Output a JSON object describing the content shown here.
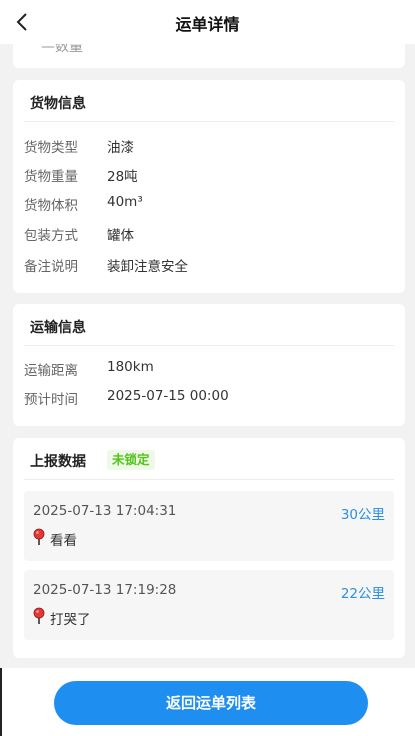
{
  "header": {
    "title": "运单详情",
    "back_icon": "chevron-left-icon"
  },
  "previous_card": {
    "partial_text": "—数量"
  },
  "cargo": {
    "title": "货物信息",
    "rows": [
      {
        "label": "货物类型",
        "value": "油漆"
      },
      {
        "label": "货物重量",
        "value": "28吨"
      },
      {
        "label": "货物体积",
        "value": "40m³"
      },
      {
        "label": "包装方式",
        "value": "罐体"
      },
      {
        "label": "备注说明",
        "value": "装卸注意安全"
      }
    ]
  },
  "transport": {
    "title": "运输信息",
    "rows": [
      {
        "label": "运输距离",
        "value": "180km"
      },
      {
        "label": "预计时间",
        "value": "2025-07-15 00:00"
      }
    ]
  },
  "report": {
    "title": "上报数据",
    "status": "未锁定",
    "status_color": "#52c41a",
    "items": [
      {
        "time": "2025-07-13 17:04:31",
        "distance": "30公里",
        "note": "看看",
        "icon": "map-pin-icon"
      },
      {
        "time": "2025-07-13 17:19:28",
        "distance": "22公里",
        "note": "打哭了",
        "icon": "map-pin-icon"
      }
    ]
  },
  "footer": {
    "return_label": "返回运单列表",
    "accent": "#1f8ef1"
  }
}
